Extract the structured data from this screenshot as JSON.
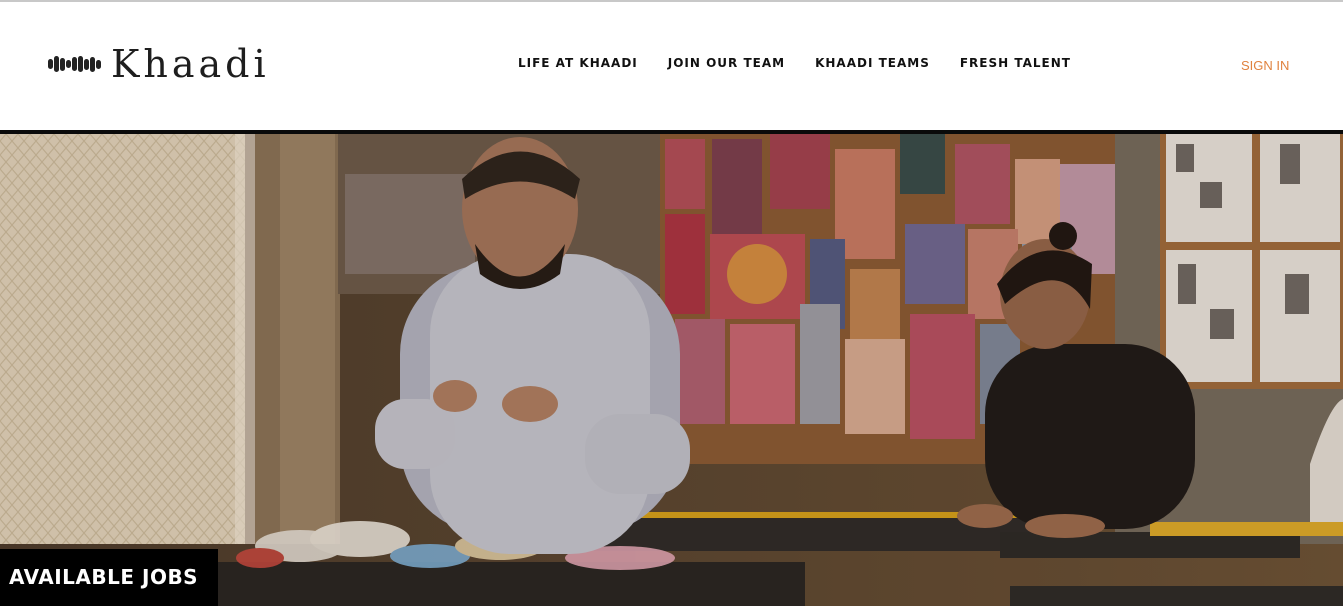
{
  "brand": {
    "name": "Khaadi",
    "logo_mark_icon": "khaadi-wave-mark-icon"
  },
  "nav": {
    "items": [
      {
        "label": "LIFE AT KHAADI"
      },
      {
        "label": "JOIN OUR TEAM"
      },
      {
        "label": "KHAADI TEAMS"
      },
      {
        "label": "FRESH TALENT"
      }
    ],
    "sign_in": "SIGN IN"
  },
  "hero": {
    "cta": "AVAILABLE JOBS"
  },
  "colors": {
    "accent": "#e0823e",
    "header_bg": "#ffffff",
    "hero_bar": "#0a0a0a",
    "cta_bg": "#000000"
  }
}
